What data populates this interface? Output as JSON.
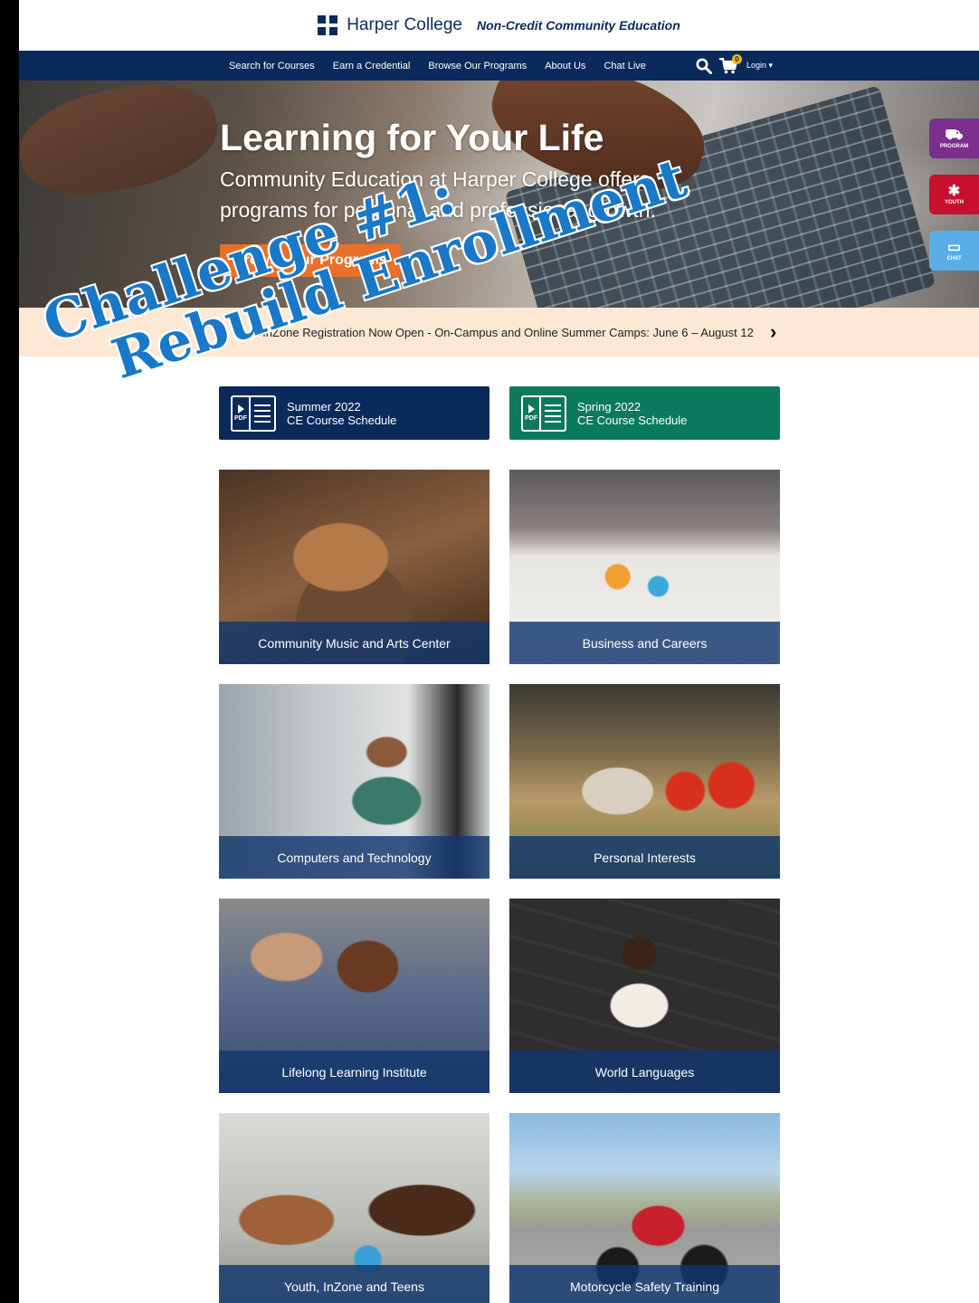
{
  "brand": {
    "name": "Harper College",
    "subtitle": "Non-Credit Community Education"
  },
  "nav": {
    "links": [
      "Search for Courses",
      "Earn a Credential",
      "Browse Our Programs",
      "About Us",
      "Chat Live"
    ],
    "cart_count": "0",
    "login_label": "Login ▾"
  },
  "hero": {
    "title": "Learning for Your Life",
    "text": "Community Education at Harper College offers programs for personal and professional growth.",
    "button": "Browse Our Programs"
  },
  "side_tabs": [
    {
      "label": "PROGRAM",
      "icon": "motorcycle-icon",
      "color": "#7a2e8e"
    },
    {
      "label": "YOUTH",
      "icon": "youth-icon",
      "color": "#c8102e"
    },
    {
      "label": "CHAT",
      "icon": "chat-icon",
      "color": "#5aaee8"
    }
  ],
  "announcement": "InZone Registration Now Open - On-Campus and Online Summer Camps: June 6 – August 12",
  "schedules": [
    {
      "line1": "Summer 2022",
      "line2": "CE Course Schedule",
      "color": "#0b2a5c"
    },
    {
      "line1": "Spring 2022",
      "line2": "CE Course Schedule",
      "color": "#0b7a5c"
    }
  ],
  "tiles": [
    "Community Music and Arts Center",
    "Business and Careers",
    "Computers and Technology",
    "Personal Interests",
    "Lifelong Learning Institute",
    "World Languages",
    "Youth, InZone and Teens",
    "Motorcycle Safety Training"
  ],
  "watermark": {
    "line1": "Challenge #1:",
    "line2": "Rebuild Enrollment"
  }
}
